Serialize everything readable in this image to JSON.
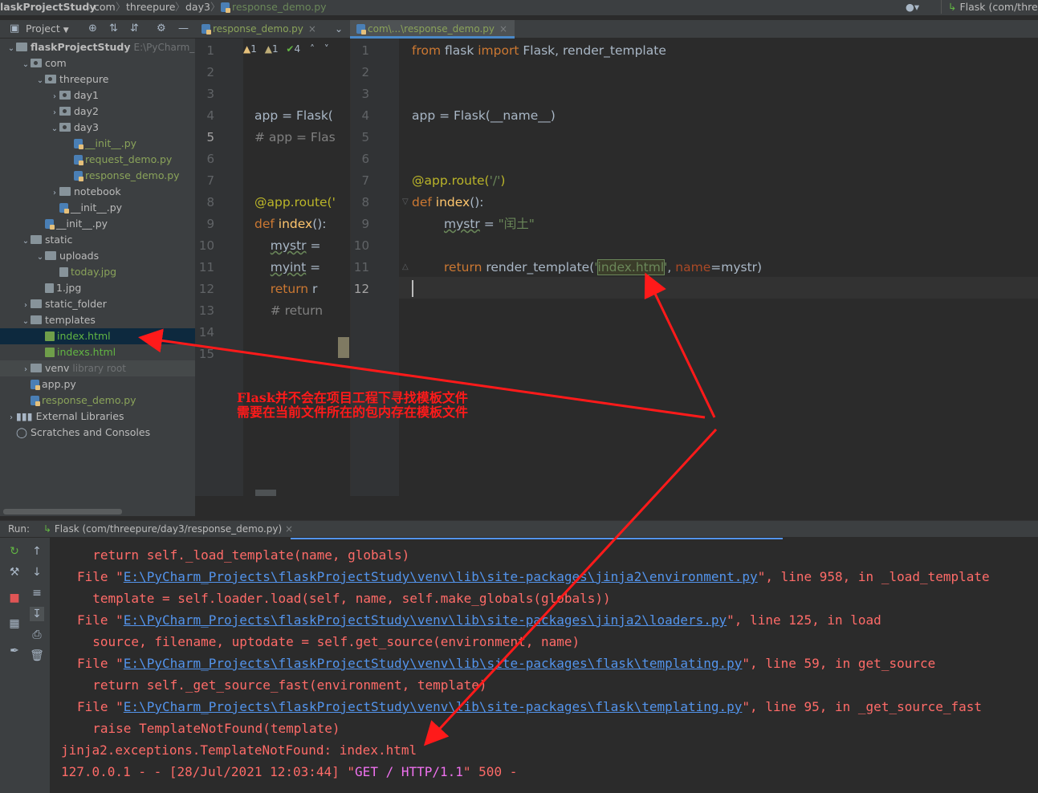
{
  "navbar": {
    "project": "laskProjectStudy",
    "crumbs": [
      "com",
      "threepure",
      "day3"
    ],
    "file": "response_demo.py",
    "run_config": "Flask (com/thre"
  },
  "project_toolbar": {
    "label": "Project"
  },
  "tree": [
    {
      "label": "flaskProjectStudy",
      "extra": "E:\\PyCharm_Pr",
      "kind": "folder",
      "depth": 0,
      "arrow": "down",
      "bold": true
    },
    {
      "label": "com",
      "kind": "pkg",
      "depth": 1,
      "arrow": "down"
    },
    {
      "label": "threepure",
      "kind": "pkg",
      "depth": 2,
      "arrow": "down"
    },
    {
      "label": "day1",
      "kind": "pkg",
      "depth": 3,
      "arrow": "right"
    },
    {
      "label": "day2",
      "kind": "pkg",
      "depth": 3,
      "arrow": "right"
    },
    {
      "label": "day3",
      "kind": "pkg",
      "depth": 3,
      "arrow": "down"
    },
    {
      "label": "__init__.py",
      "kind": "py",
      "depth": 4,
      "color": "olive"
    },
    {
      "label": "request_demo.py",
      "kind": "py",
      "depth": 4,
      "color": "olive"
    },
    {
      "label": "response_demo.py",
      "kind": "py",
      "depth": 4,
      "color": "olive"
    },
    {
      "label": "notebook",
      "kind": "folder",
      "depth": 3,
      "arrow": "right"
    },
    {
      "label": "__init__.py",
      "kind": "py",
      "depth": 3
    },
    {
      "label": "__init__.py",
      "kind": "py",
      "depth": 2
    },
    {
      "label": "static",
      "kind": "folder",
      "depth": 1,
      "arrow": "down"
    },
    {
      "label": "uploads",
      "kind": "folder",
      "depth": 2,
      "arrow": "down"
    },
    {
      "label": "today.jpg",
      "kind": "img",
      "depth": 3,
      "color": "olive"
    },
    {
      "label": "1.jpg",
      "kind": "img",
      "depth": 2
    },
    {
      "label": "static_folder",
      "kind": "folder",
      "depth": 1,
      "arrow": "right"
    },
    {
      "label": "templates",
      "kind": "folder",
      "depth": 1,
      "arrow": "down"
    },
    {
      "label": "index.html",
      "kind": "html",
      "depth": 2,
      "color": "green",
      "selected": true
    },
    {
      "label": "indexs.html",
      "kind": "html",
      "depth": 2,
      "color": "green"
    },
    {
      "label": "venv",
      "extra": "library root",
      "kind": "folder",
      "depth": 1,
      "arrow": "right",
      "venv": true
    },
    {
      "label": "app.py",
      "kind": "py",
      "depth": 1
    },
    {
      "label": "response_demo.py",
      "kind": "py",
      "depth": 1,
      "color": "olive"
    },
    {
      "label": "External Libraries",
      "kind": "lib",
      "depth": 0,
      "arrow": "right"
    },
    {
      "label": "Scratches and Consoles",
      "kind": "scratch",
      "depth": 0
    }
  ],
  "tabs": {
    "left": "response_demo.py",
    "right": "com\\...\\response_demo.py"
  },
  "inspection": {
    "warn1": "1",
    "warn2": "1",
    "ok": "4"
  },
  "left_editor": {
    "line_numbers": [
      "1",
      "2",
      "3",
      "4",
      "5",
      "6",
      "7",
      "8",
      "9",
      "10",
      "11",
      "12",
      "13",
      "14",
      "15"
    ],
    "lines": [
      "",
      "",
      "",
      "app = Flask(",
      "# app = Flas",
      "",
      "",
      "@app.route('",
      "def index():",
      "    mystr =",
      "    myint =",
      "    return r",
      "    # return",
      "",
      ""
    ]
  },
  "right_editor": {
    "line_numbers": [
      "1",
      "2",
      "3",
      "4",
      "5",
      "6",
      "7",
      "8",
      "9",
      "10",
      "11",
      "12"
    ],
    "l1_from": "from",
    "l1_mod": " flask ",
    "l1_import": "import",
    "l1_rest": " Flask, render_template",
    "l4": "app = Flask(__name__)",
    "l7_dec": "@app.route(",
    "l7_str": "'/'",
    "l7_end": ")",
    "l8_def": "def",
    "l8_fn": " index",
    "l8_end": "():",
    "l9_var": "mystr",
    "l9_eq": " = ",
    "l9_str": "\"闰土\"",
    "l11_ret": "return",
    "l11_mid": " render_template(",
    "l11_q1": "'",
    "l11_tpl": "index.html",
    "l11_q2": "'",
    "l11_comma": ", ",
    "l11_kw": "name",
    "l11_end": "=mystr)"
  },
  "run": {
    "label": "Run:",
    "tab": "Flask (com/threepure/day3/response_demo.py)"
  },
  "console": {
    "l1": "  return self._load_template(name, globals)",
    "l2_pre": "File \"",
    "l2_link": "E:\\PyCharm_Projects\\flaskProjectStudy\\venv\\lib\\site-packages\\jinja2\\environment.py",
    "l2_post": "\", line 958, in _load_template",
    "l3": "  template = self.loader.load(self, name, self.make_globals(globals))",
    "l4_pre": "File \"",
    "l4_link": "E:\\PyCharm_Projects\\flaskProjectStudy\\venv\\lib\\site-packages\\jinja2\\loaders.py",
    "l4_post": "\", line 125, in load",
    "l5": "  source, filename, uptodate = self.get_source(environment, name)",
    "l6_pre": "File \"",
    "l6_link": "E:\\PyCharm_Projects\\flaskProjectStudy\\venv\\lib\\site-packages\\flask\\templating.py",
    "l6_post": "\", line 59, in get_source",
    "l7": "  return self._get_source_fast(environment, template)",
    "l8_pre": "File \"",
    "l8_link": "E:\\PyCharm_Projects\\flaskProjectStudy\\venv\\lib\\site-packages\\flask\\templating.py",
    "l8_post": "\", line 95, in _get_source_fast",
    "l9": "  raise TemplateNotFound(template)",
    "l10": "jinja2.exceptions.TemplateNotFound: index.html",
    "l11_pre": "127.0.0.1 - - [28/Jul/2021 12:03:44] \"",
    "l11_get": "GET / HTTP/1.1",
    "l11_post": "\" 500 -"
  },
  "annotation": {
    "line1": "Flask并不会在项目工程下寻找模板文件",
    "line2": "需要在当前文件所在的包内存在模板文件"
  },
  "colors": {
    "arrow": "#ff1a1a",
    "selection": "#0d293e",
    "link": "#5394ec",
    "error": "#ff6b68"
  }
}
